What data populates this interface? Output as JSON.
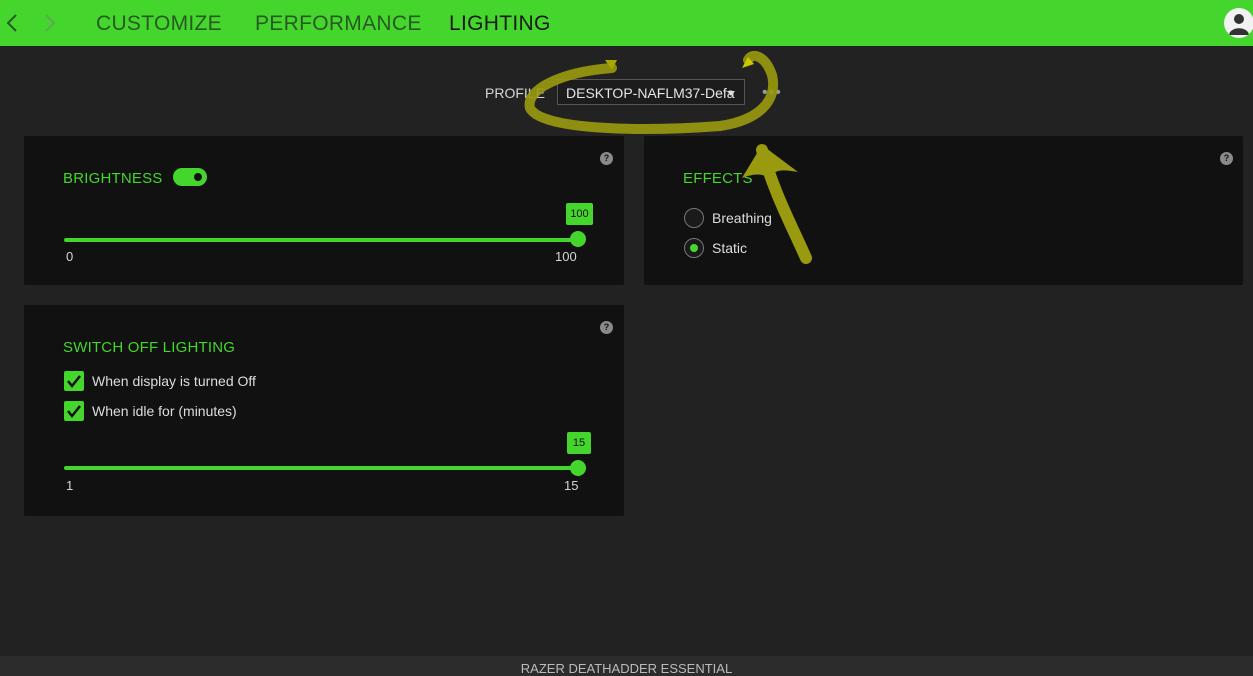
{
  "nav": {
    "tabs": [
      {
        "label": "CUSTOMIZE"
      },
      {
        "label": "PERFORMANCE"
      },
      {
        "label": "LIGHTING"
      }
    ],
    "active_tab": "LIGHTING"
  },
  "profile": {
    "label": "PROFILE",
    "value": "DESKTOP-NAFLM37-Defa",
    "more": "•••"
  },
  "brightness": {
    "title": "BRIGHTNESS",
    "enabled": true,
    "value": "100",
    "min": "0",
    "max": "100",
    "help": "?"
  },
  "effects": {
    "title": "EFFECTS",
    "help": "?",
    "options": [
      {
        "label": "Breathing",
        "selected": false
      },
      {
        "label": "Static",
        "selected": true
      }
    ]
  },
  "switch_off": {
    "title": "SWITCH OFF LIGHTING",
    "help": "?",
    "options": [
      {
        "label": "When display is turned Off",
        "checked": true
      },
      {
        "label": "When idle for (minutes)",
        "checked": true
      }
    ],
    "value": "15",
    "min": "1",
    "max": "15"
  },
  "footer": {
    "device": "RAZER DEATHADDER ESSENTIAL"
  },
  "colors": {
    "accent": "#44d62c",
    "background": "#222222",
    "panel": "#111111",
    "annotation": "#a8a800"
  }
}
